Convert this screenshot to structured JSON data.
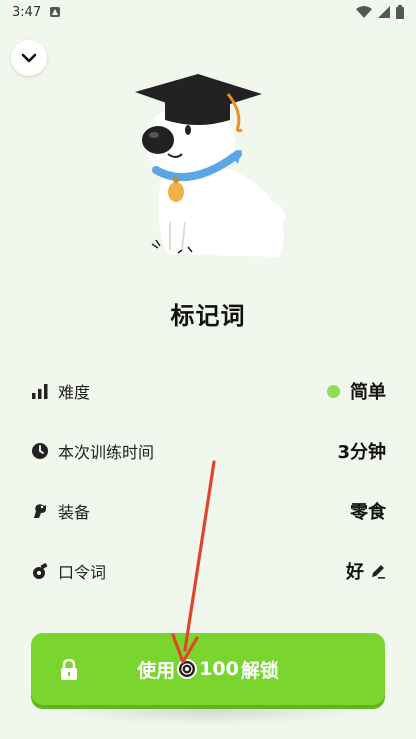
{
  "status_bar": {
    "time": "3:47"
  },
  "title": "标记词",
  "rows": [
    {
      "label": "难度",
      "value": "简单",
      "icon": "signal-bars-icon"
    },
    {
      "label": "本次训练时间",
      "value": "3分钟",
      "icon": "clock-icon"
    },
    {
      "label": "装备",
      "value": "零食",
      "icon": "treat-icon"
    },
    {
      "label": "口令词",
      "value": "好",
      "icon": "whistle-icon"
    }
  ],
  "unlock_button": {
    "prefix": "使用",
    "amount": "100",
    "suffix": "解锁"
  },
  "colors": {
    "accent": "#7bd52f",
    "difficulty_dot": "#8fdd55",
    "background": "#f1f7ec",
    "arrow": "#e0452b"
  }
}
